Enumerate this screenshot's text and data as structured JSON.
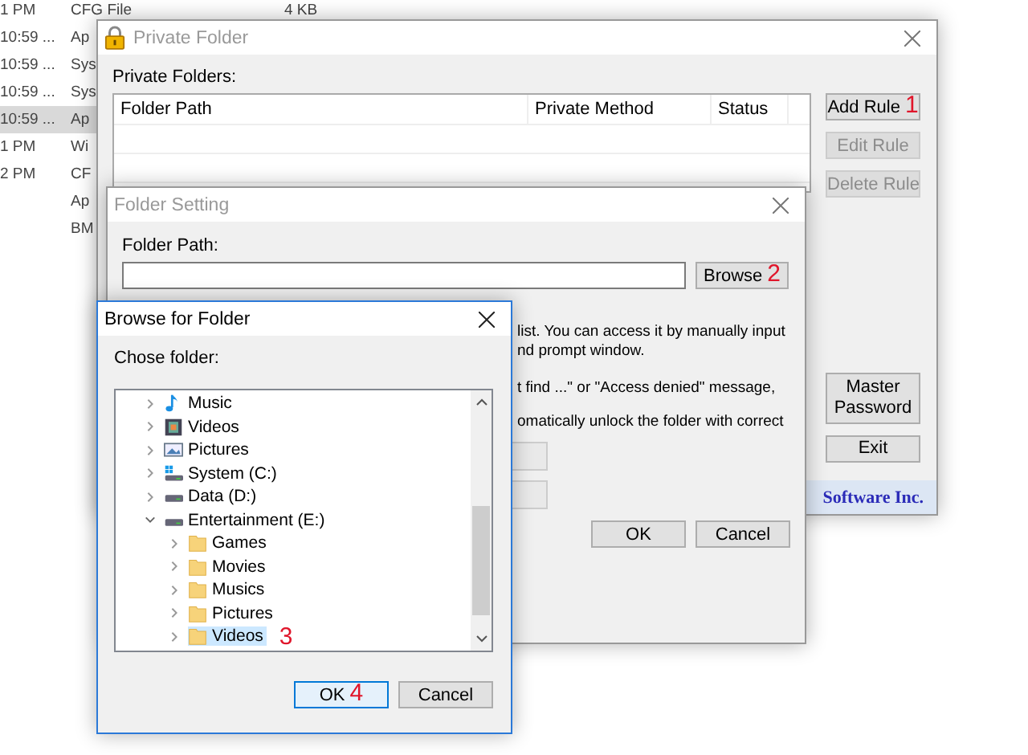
{
  "background_list": {
    "rows": [
      {
        "time": "1 PM",
        "type": "CFG File",
        "size": "4 KB",
        "selected": false
      },
      {
        "time": "10:59 ...",
        "type": "Ap",
        "selected": false
      },
      {
        "time": "10:59 ...",
        "type": "Sys",
        "selected": false
      },
      {
        "time": "10:59 ...",
        "type": "Sys",
        "selected": false
      },
      {
        "time": "10:59 ...",
        "type": "Ap",
        "selected": true
      },
      {
        "time": "1 PM",
        "type": "Wi",
        "selected": false
      },
      {
        "time": "2 PM",
        "type": "CF",
        "selected": false
      },
      {
        "type": "Ap",
        "selected": false
      },
      {
        "type": "BM",
        "selected": false
      }
    ]
  },
  "private_folder": {
    "title": "Private Folder",
    "label": "Private Folders:",
    "columns": [
      "Folder Path",
      "Private Method",
      "Status"
    ],
    "top_buttons": [
      {
        "label": "Add Rule",
        "disabled": false,
        "annotation": "1"
      },
      {
        "label": "Edit Rule",
        "disabled": true
      },
      {
        "label": "Delete Rule",
        "disabled": true
      }
    ],
    "bottom_buttons": [
      {
        "label": "Master Password",
        "disabled": false
      },
      {
        "label": "Exit",
        "disabled": false
      }
    ],
    "footer": "Software Inc."
  },
  "folder_setting": {
    "title": "Folder Setting",
    "path_label": "Folder Path:",
    "browse_button": {
      "label": "Browse",
      "annotation": "2"
    },
    "notes": [
      [
        "list. You can access it by manually input",
        "nd prompt window."
      ],
      [
        "t find ...\" or \"Access denied\" message,"
      ],
      [
        "omatically unlock the folder with correct"
      ]
    ],
    "buttons": [
      "OK",
      "Cancel"
    ]
  },
  "browse_dialog": {
    "title": "Browse for Folder",
    "label": "Chose folder:",
    "tree": [
      {
        "label": "Music",
        "kind": "music",
        "expanded": false
      },
      {
        "label": "Videos",
        "kind": "video",
        "expanded": false
      },
      {
        "label": "Pictures",
        "kind": "picture",
        "expanded": false
      },
      {
        "label": "System (C:)",
        "kind": "system",
        "expanded": false
      },
      {
        "label": "Data (D:)",
        "kind": "drive",
        "expanded": false
      },
      {
        "label": "Entertainment (E:)",
        "kind": "drive",
        "expanded": true,
        "children": [
          {
            "label": "Games",
            "kind": "folder",
            "expanded": false,
            "selected": false
          },
          {
            "label": "Movies",
            "kind": "folder",
            "expanded": false,
            "selected": false
          },
          {
            "label": "Musics",
            "kind": "folder",
            "expanded": false,
            "selected": false
          },
          {
            "label": "Pictures",
            "kind": "folder",
            "expanded": false,
            "selected": false
          },
          {
            "label": "Videos",
            "kind": "folder",
            "expanded": false,
            "selected": true,
            "annotation": "3"
          }
        ]
      }
    ],
    "buttons": [
      {
        "label": "OK",
        "default": true,
        "annotation": "4"
      },
      {
        "label": "Cancel",
        "default": false
      }
    ]
  }
}
